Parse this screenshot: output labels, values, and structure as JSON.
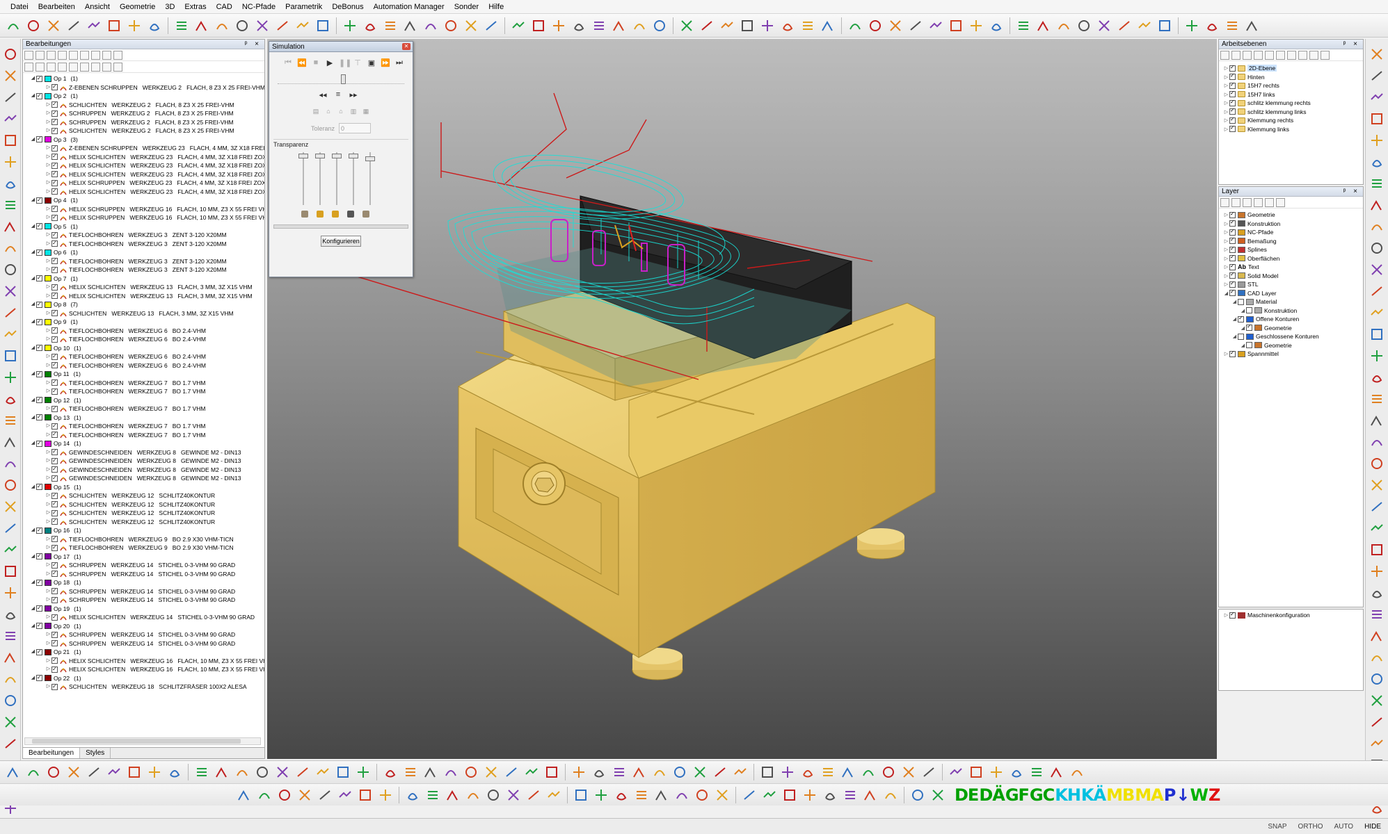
{
  "menu": [
    "Datei",
    "Bearbeiten",
    "Ansicht",
    "Geometrie",
    "3D",
    "Extras",
    "CAD",
    "NC-Pfade",
    "Parametrik",
    "DeBonus",
    "Automation Manager",
    "Sonder",
    "Hilfe"
  ],
  "left_panel": {
    "title": "Bearbeitungen",
    "header_buttons": "ᵖ ×",
    "tabs": [
      "Bearbeitungen",
      "Styles"
    ],
    "operations": [
      {
        "label": "Op 1",
        "count": "(1)",
        "color": "#00e5e5",
        "children": [
          "Z-EBENEN SCHRUPPEN   WERKZEUG 2   FLACH, 8 Z3 X 25 FREI-VHM"
        ]
      },
      {
        "label": "Op 2",
        "count": "(1)",
        "color": "#00e5e5",
        "children": [
          "SCHLICHTEN   WERKZEUG 2   FLACH, 8 Z3 X 25 FREI-VHM",
          "SCHRUPPEN   WERKZEUG 2   FLACH, 8 Z3 X 25 FREI-VHM",
          "SCHRUPPEN   WERKZEUG 2   FLACH, 8 Z3 X 25 FREI-VHM",
          "SCHLICHTEN   WERKZEUG 2   FLACH, 8 Z3 X 25 FREI-VHM"
        ]
      },
      {
        "label": "Op 3",
        "count": "(3)",
        "color": "#e000e0",
        "children": [
          "Z-EBENEN SCHRUPPEN   WERKZEUG 23   FLACH, 4 MM, 3Z X18 FREI ZO",
          "HELIX SCHLICHTEN   WERKZEUG 23   FLACH, 4 MM, 3Z X18 FREI ZOX",
          "HELIX SCHLICHTEN   WERKZEUG 23   FLACH, 4 MM, 3Z X18 FREI ZOX",
          "HELIX SCHLICHTEN   WERKZEUG 23   FLACH, 4 MM, 3Z X18 FREI ZOX",
          "HELIX SCHRUPPEN   WERKZEUG 23   FLACH, 4 MM, 3Z X18 FREI ZOX",
          "HELIX SCHLICHTEN   WERKZEUG 23   FLACH, 4 MM, 3Z X18 FREI ZOX"
        ]
      },
      {
        "label": "Op 4",
        "count": "(1)",
        "color": "#8b0000",
        "children": [
          "HELIX SCHRUPPEN   WERKZEUG 16   FLACH, 10 MM, Z3 X 55 FREI VHM",
          "HELIX SCHRUPPEN   WERKZEUG 16   FLACH, 10 MM, Z3 X 55 FREI VHM"
        ]
      },
      {
        "label": "Op 5",
        "count": "(1)",
        "color": "#00e5e5",
        "children": [
          "TIEFLOCHBOHREN   WERKZEUG 3   ZENT 3-120 X20MM",
          "TIEFLOCHBOHREN   WERKZEUG 3   ZENT 3-120 X20MM"
        ]
      },
      {
        "label": "Op 6",
        "count": "(1)",
        "color": "#00e5e5",
        "children": [
          "TIEFLOCHBOHREN   WERKZEUG 3   ZENT 3-120 X20MM",
          "TIEFLOCHBOHREN   WERKZEUG 3   ZENT 3-120 X20MM"
        ]
      },
      {
        "label": "Op 7",
        "count": "(1)",
        "color": "#ffff00",
        "children": [
          "HELIX SCHLICHTEN   WERKZEUG 13   FLACH, 3 MM, 3Z X15 VHM",
          "HELIX SCHLICHTEN   WERKZEUG 13   FLACH, 3 MM, 3Z X15 VHM"
        ]
      },
      {
        "label": "Op 8",
        "count": "(7)",
        "color": "#ffff00",
        "children": [
          "SCHLICHTEN   WERKZEUG 13   FLACH, 3 MM, 3Z X15 VHM"
        ]
      },
      {
        "label": "Op 9",
        "count": "(1)",
        "color": "#ffff00",
        "children": [
          "TIEFLOCHBOHREN   WERKZEUG 6   BO 2.4-VHM",
          "TIEFLOCHBOHREN   WERKZEUG 6   BO 2.4-VHM"
        ]
      },
      {
        "label": "Op 10",
        "count": "(1)",
        "color": "#ffff00",
        "children": [
          "TIEFLOCHBOHREN   WERKZEUG 6   BO 2.4-VHM",
          "TIEFLOCHBOHREN   WERKZEUG 6   BO 2.4-VHM"
        ]
      },
      {
        "label": "Op 11",
        "count": "(1)",
        "color": "#008000",
        "children": [
          "TIEFLOCHBOHREN   WERKZEUG 7   BO 1.7 VHM",
          "TIEFLOCHBOHREN   WERKZEUG 7   BO 1.7 VHM"
        ]
      },
      {
        "label": "Op 12",
        "count": "(1)",
        "color": "#008000",
        "children": [
          "TIEFLOCHBOHREN   WERKZEUG 7   BO 1.7 VHM"
        ]
      },
      {
        "label": "Op 13",
        "count": "(1)",
        "color": "#008000",
        "children": [
          "TIEFLOCHBOHREN   WERKZEUG 7   BO 1.7 VHM",
          "TIEFLOCHBOHREN   WERKZEUG 7   BO 1.7 VHM"
        ]
      },
      {
        "label": "Op 14",
        "count": "(1)",
        "color": "#e000e0",
        "children": [
          "GEWINDESCHNEIDEN   WERKZEUG 8   GEWINDE M2 - DIN13",
          "GEWINDESCHNEIDEN   WERKZEUG 8   GEWINDE M2 - DIN13",
          "GEWINDESCHNEIDEN   WERKZEUG 8   GEWINDE M2 - DIN13",
          "GEWINDESCHNEIDEN   WERKZEUG 8   GEWINDE M2 - DIN13"
        ]
      },
      {
        "label": "Op 15",
        "count": "(1)",
        "color": "#e00000",
        "children": [
          "SCHLICHTEN   WERKZEUG 12   SCHLITZ40KONTUR",
          "SCHLICHTEN   WERKZEUG 12   SCHLITZ40KONTUR",
          "SCHLICHTEN   WERKZEUG 12   SCHLITZ40KONTUR",
          "SCHLICHTEN   WERKZEUG 12   SCHLITZ40KONTUR"
        ]
      },
      {
        "label": "Op 16",
        "count": "(1)",
        "color": "#008080",
        "children": [
          "TIEFLOCHBOHREN   WERKZEUG 9   BO 2.9 X30 VHM-TICN",
          "TIEFLOCHBOHREN   WERKZEUG 9   BO 2.9 X30 VHM-TICN"
        ]
      },
      {
        "label": "Op 17",
        "count": "(1)",
        "color": "#8000a0",
        "children": [
          "SCHRUPPEN   WERKZEUG 14   STICHEL 0-3-VHM 90 GRAD",
          "SCHRUPPEN   WERKZEUG 14   STICHEL 0-3-VHM 90 GRAD"
        ]
      },
      {
        "label": "Op 18",
        "count": "(1)",
        "color": "#8000a0",
        "children": [
          "SCHRUPPEN   WERKZEUG 14   STICHEL 0-3-VHM 90 GRAD",
          "SCHRUPPEN   WERKZEUG 14   STICHEL 0-3-VHM 90 GRAD"
        ]
      },
      {
        "label": "Op 19",
        "count": "(1)",
        "color": "#8000a0",
        "children": [
          "HELIX SCHLICHTEN   WERKZEUG 14   STICHEL 0-3-VHM 90 GRAD"
        ]
      },
      {
        "label": "Op 20",
        "count": "(1)",
        "color": "#8000a0",
        "children": [
          "SCHRUPPEN   WERKZEUG 14   STICHEL 0-3-VHM 90 GRAD",
          "SCHRUPPEN   WERKZEUG 14   STICHEL 0-3-VHM 90 GRAD"
        ]
      },
      {
        "label": "Op 21",
        "count": "(1)",
        "color": "#8b0000",
        "children": [
          "HELIX SCHLICHTEN   WERKZEUG 16   FLACH, 10 MM, Z3 X 55 FREI VH",
          "HELIX SCHLICHTEN   WERKZEUG 16   FLACH, 10 MM, Z3 X 55 FREI VH"
        ]
      },
      {
        "label": "Op 22",
        "count": "(1)",
        "color": "#8b0000",
        "children": [
          "SCHLICHTEN   WERKZEUG 18   SCHLITZFRÄSER 100X2 ALESA"
        ]
      }
    ]
  },
  "simulation": {
    "title": "Simulation",
    "tolerance_label": "Toleranz",
    "tolerance_value": "0",
    "transparency_label": "Transparenz",
    "configure_button": "Konfigurieren",
    "position": 0.5
  },
  "workplanes": {
    "title": "Arbeitsebenen",
    "items": [
      "2D-Ebene",
      "Hinten",
      "15H7 rechts",
      "15H7 links",
      "schlitz klemmung rechts",
      "schlitz klemmung links",
      "Klemmung rechts",
      "Klemmung links"
    ]
  },
  "layer": {
    "title": "Layer",
    "items": [
      {
        "label": "Geometrie",
        "indent": 0,
        "checked": true,
        "icon": "#c8742c"
      },
      {
        "label": "Konstruktion",
        "indent": 0,
        "checked": true,
        "icon": "#555555"
      },
      {
        "label": "NC-Pfade",
        "indent": 0,
        "checked": true,
        "icon": "#d8a020"
      },
      {
        "label": "Bemaßung",
        "indent": 0,
        "checked": true,
        "icon": "#d06020"
      },
      {
        "label": "Splines",
        "indent": 0,
        "checked": true,
        "icon": "#c03030"
      },
      {
        "label": "Oberflächen",
        "indent": 0,
        "checked": true,
        "icon": "#e0c040"
      },
      {
        "label": "Text",
        "indent": 0,
        "checked": true,
        "icon": "#333333",
        "prefix": "Ab"
      },
      {
        "label": "Solid Model",
        "indent": 0,
        "checked": true,
        "icon": "#d8b850"
      },
      {
        "label": "STL",
        "indent": 0,
        "checked": true,
        "icon": "#9a9a9a"
      },
      {
        "label": "CAD Layer",
        "indent": 0,
        "checked": true,
        "icon": "#3070c0"
      },
      {
        "label": "Material",
        "indent": 1,
        "checked": false,
        "icon": "#aaaaaa"
      },
      {
        "label": "Konstruktion",
        "indent": 2,
        "checked": false,
        "icon": "#aaaaaa"
      },
      {
        "label": "Offene Konturen",
        "indent": 1,
        "checked": true,
        "icon": "#2060d0"
      },
      {
        "label": "Geometrie",
        "indent": 2,
        "checked": true,
        "icon": "#c8742c"
      },
      {
        "label": "Geschlossene Konturen",
        "indent": 1,
        "checked": false,
        "icon": "#2060d0"
      },
      {
        "label": "Geometrie",
        "indent": 2,
        "checked": false,
        "icon": "#c8742c"
      },
      {
        "label": "Spannmittel",
        "indent": 0,
        "checked": true,
        "icon": "#d8a020"
      }
    ]
  },
  "machine_panel": {
    "items": [
      "Maschinenkonfiguration"
    ]
  },
  "abc_bar": [
    "DE",
    "DÄ",
    "GF",
    "GC",
    "KH",
    "KÄ",
    "MB",
    "MA",
    "P",
    "↓",
    "W",
    "Z"
  ],
  "abc_colors": [
    "#00a000",
    "#00a000",
    "#00a000",
    "#00a000",
    "#00c0e0",
    "#00c0e0",
    "#f0e000",
    "#f0e000",
    "#2030d0",
    "#2030d0",
    "#00b000",
    "#e01010"
  ],
  "status": [
    "SNAP",
    "ORTHO",
    "AUTO",
    "HIDE"
  ],
  "colors": {
    "part": "#e8c86a",
    "toolpath": "#19e0d8",
    "helix": "#c820c8",
    "axis": "#d02020",
    "stock": "#1c1c1c"
  }
}
